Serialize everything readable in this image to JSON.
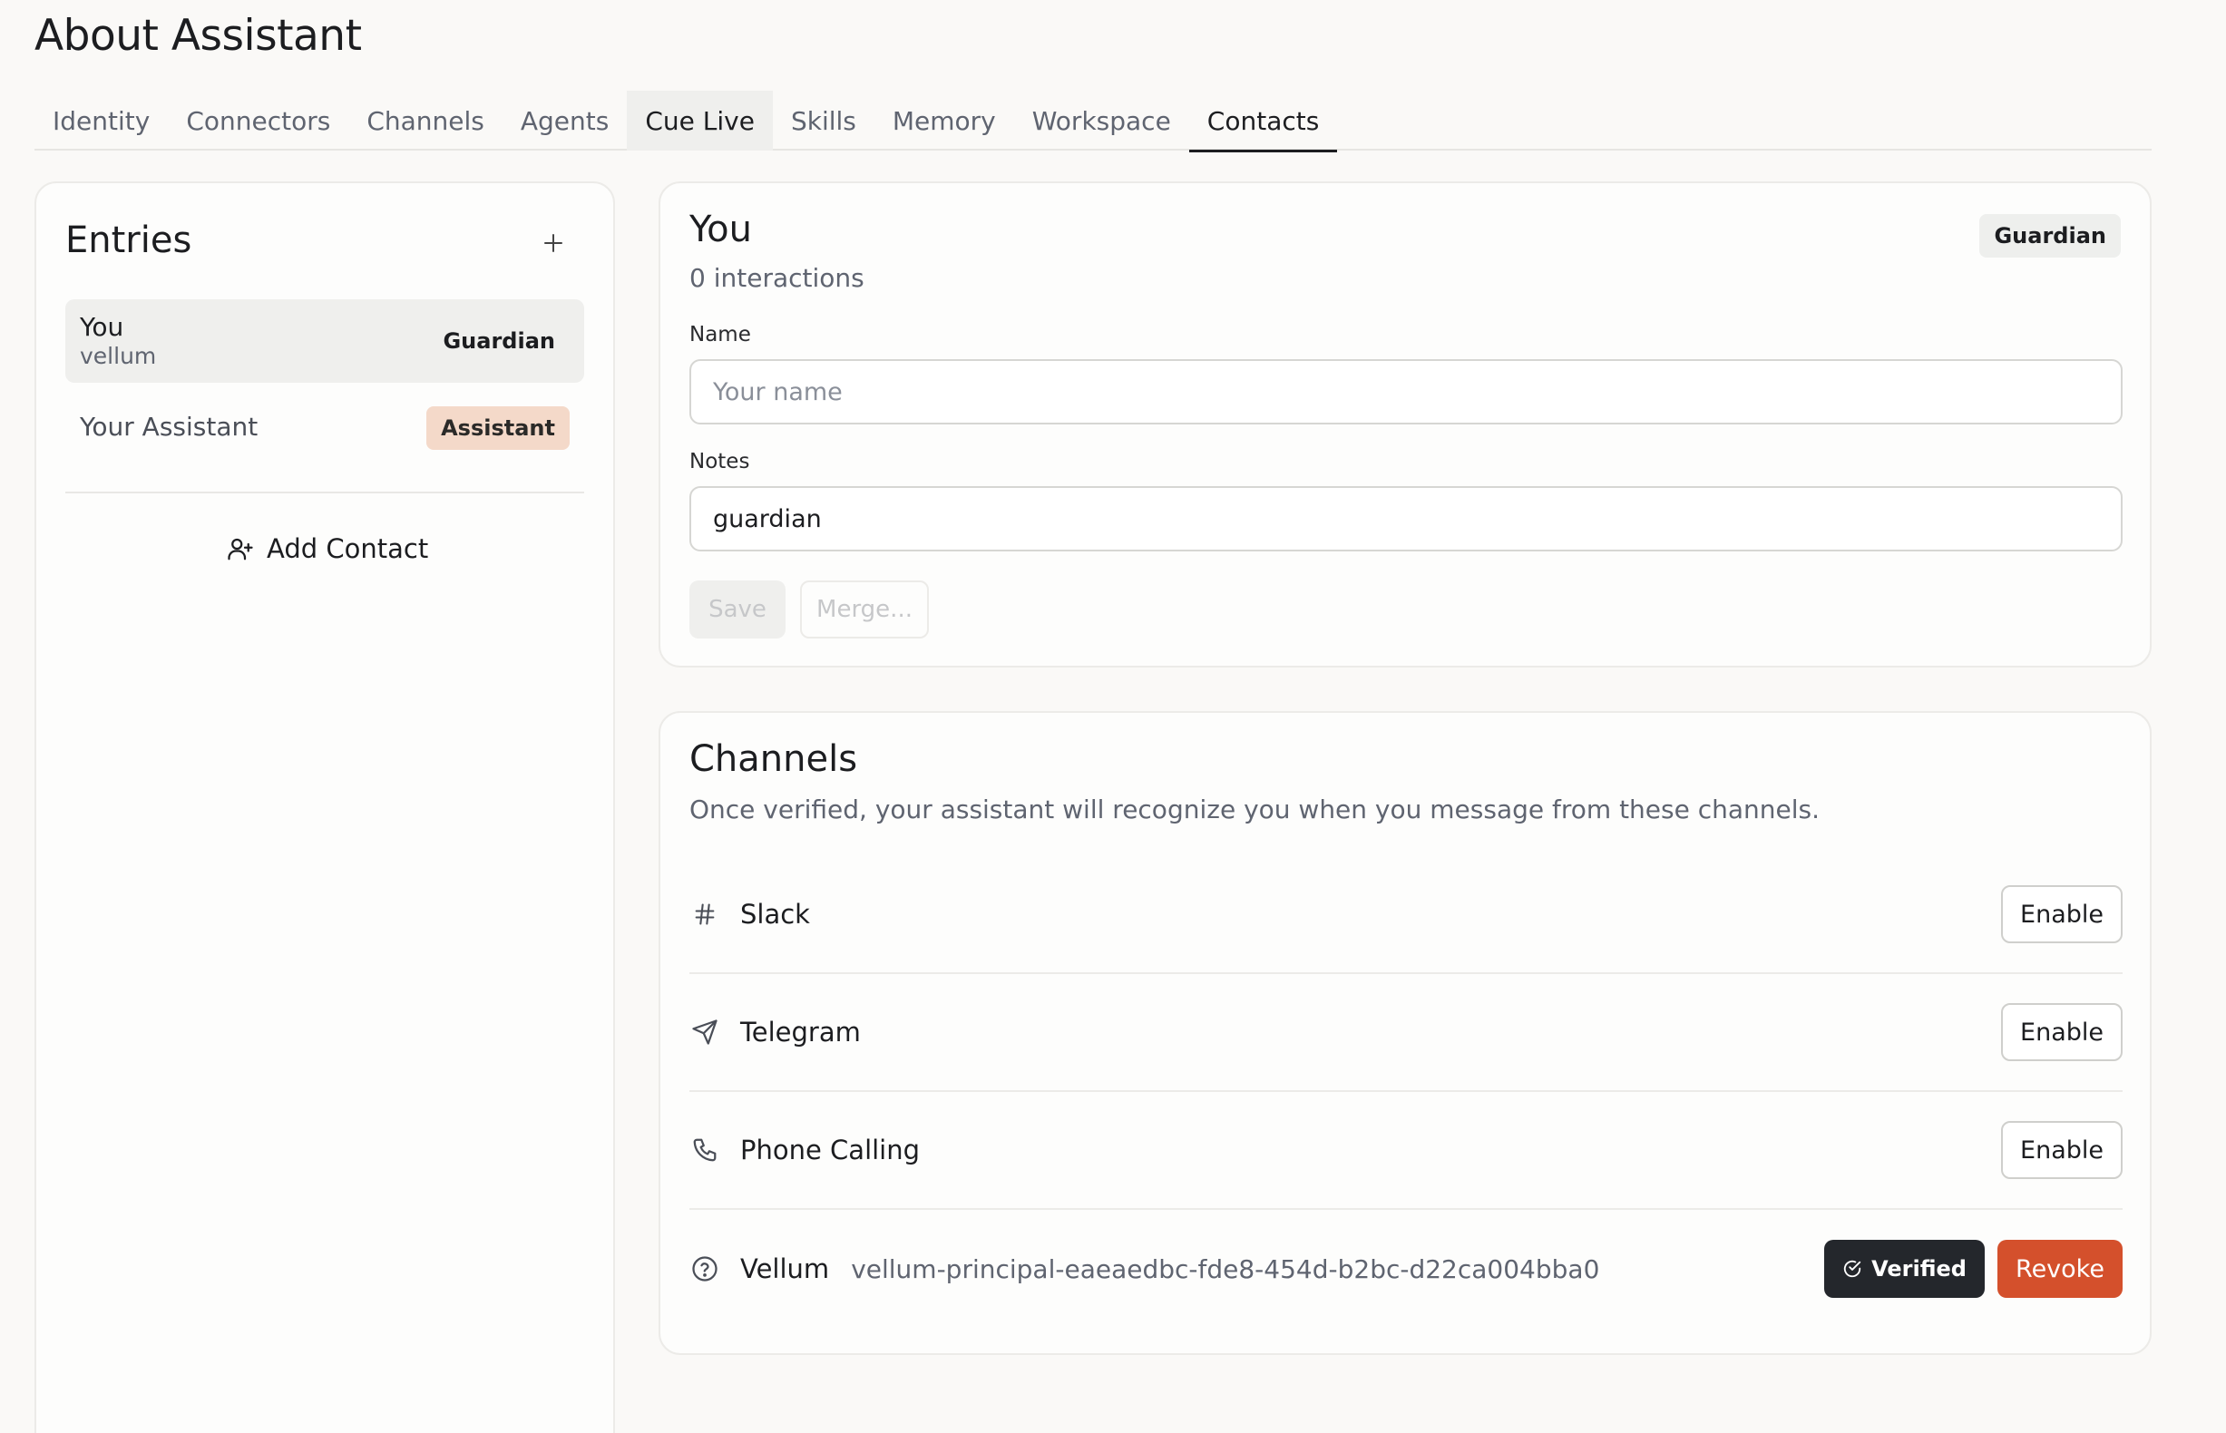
{
  "page": {
    "title": "About Assistant"
  },
  "tabs": [
    {
      "label": "Identity"
    },
    {
      "label": "Connectors"
    },
    {
      "label": "Channels"
    },
    {
      "label": "Agents"
    },
    {
      "label": "Cue Live"
    },
    {
      "label": "Skills"
    },
    {
      "label": "Memory"
    },
    {
      "label": "Workspace"
    },
    {
      "label": "Contacts"
    }
  ],
  "tab_state": {
    "hovered": "Cue Live",
    "active": "Contacts"
  },
  "entries": {
    "title": "Entries",
    "add_icon": "plus-icon",
    "items": [
      {
        "name": "You",
        "sub": "vellum",
        "badge": "Guardian",
        "selected": true
      },
      {
        "name": "Your Assistant",
        "badge": "Assistant",
        "selected": false
      }
    ],
    "add_contact_label": "Add Contact",
    "add_contact_icon": "user-plus-icon"
  },
  "profile": {
    "name": "You",
    "interactions": "0 interactions",
    "badge": "Guardian",
    "name_label": "Name",
    "name_placeholder": "Your name",
    "name_value": "",
    "notes_label": "Notes",
    "notes_value": "guardian",
    "save_label": "Save",
    "merge_label": "Merge..."
  },
  "channels": {
    "title": "Channels",
    "description": "Once verified, your assistant will recognize you when you message from these channels.",
    "items": [
      {
        "name": "Slack",
        "icon": "hash-icon",
        "action": "Enable"
      },
      {
        "name": "Telegram",
        "icon": "send-icon",
        "action": "Enable"
      },
      {
        "name": "Phone Calling",
        "icon": "phone-icon",
        "action": "Enable"
      },
      {
        "name": "Vellum",
        "icon": "help-circle-icon",
        "id": "vellum-principal-eaeaedbc-fde8-454d-b2bc-d22ca004bba0",
        "verified_label": "Verified",
        "revoke_label": "Revoke"
      }
    ]
  },
  "colors": {
    "background": "#faf9f7",
    "assistant_badge": "#f4d9c9",
    "verified": "#24272c",
    "revoke": "#d4502c"
  }
}
